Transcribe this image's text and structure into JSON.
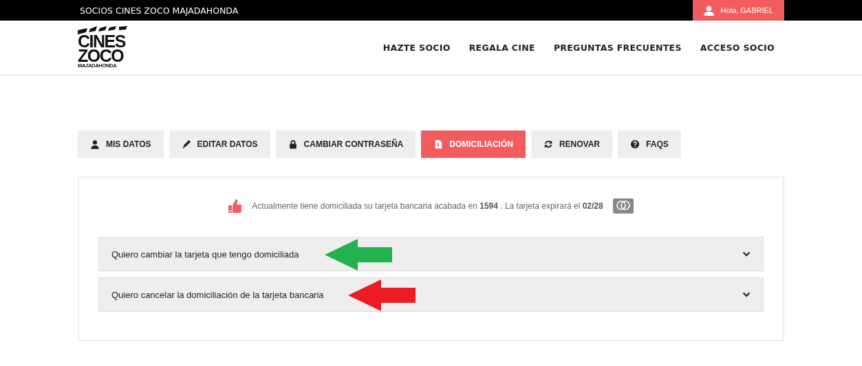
{
  "top_bar": {
    "title": "SOCIOS CINES ZOCO MAJADAHONDA",
    "user_greeting": "Hola, GABRIEL"
  },
  "logo": {
    "line_1": "CINES",
    "line_2": "ZOCO",
    "line_3": "MAJADAHONDA"
  },
  "nav": [
    "HAZTE SOCIO",
    "REGALA CINE",
    "PREGUNTAS FRECUENTES",
    "ACCESO SOCIO"
  ],
  "tabs": [
    {
      "label": "MIS DATOS",
      "kind": "user",
      "selected": false
    },
    {
      "label": "EDITAR DATOS",
      "kind": "pencil",
      "selected": false
    },
    {
      "label": "CAMBIAR CONTRASEÑA",
      "kind": "lock",
      "selected": false
    },
    {
      "label": "DOMICILIACIÓN",
      "kind": "document",
      "selected": true
    },
    {
      "label": "RENOVAR",
      "kind": "refresh",
      "selected": false
    },
    {
      "label": "FAQS",
      "kind": "question",
      "selected": false
    }
  ],
  "notice": "Actualmente tiene domiciliada su tarjeta bancaria acabada en **1594** . La tarjeta expirará el **02/28**",
  "accordion": [
    {
      "label": "Quiero cambiar la tarjeta que tengo domiciliada",
      "expanded": false,
      "color": "#22b14c"
    },
    {
      "label": "Quiero cancelar la domiciliación de la tarjeta bancaria",
      "expanded": false,
      "color": "#ed1c24"
    }
  ]
}
